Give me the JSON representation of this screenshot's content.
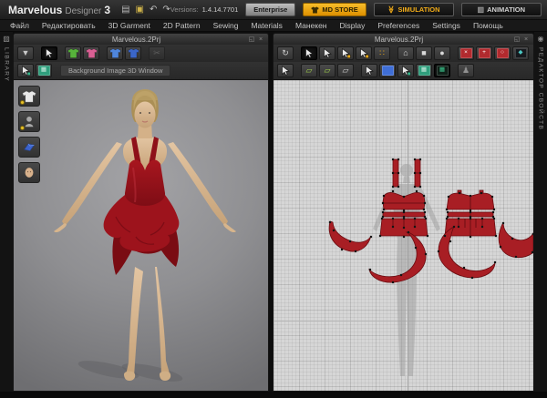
{
  "titlebar": {
    "logo": {
      "word1": "Marvelous",
      "word2": "Designer",
      "word3": "3"
    },
    "quick_icons": [
      {
        "name": "stats-icon",
        "glyph": "▤",
        "color": "#b5b5b5"
      },
      {
        "name": "open-folder-icon",
        "glyph": "▣",
        "color": "#cfb34a"
      },
      {
        "name": "undo-icon",
        "glyph": "↶",
        "color": "#bdbdbd"
      },
      {
        "name": "redo-icon",
        "glyph": "↷",
        "color": "#bdbdbd"
      }
    ],
    "version_label": "Versions:",
    "version_value": "1.4.14.7701",
    "enterprise_label": "Enterprise",
    "md_store_label": "MD STORE",
    "simulation_label": "SIMULATION",
    "simulation_icon": "≫",
    "animation_label": "ANIMATION",
    "animation_icon": "▥",
    "window": {
      "minimize": "–",
      "maximize": "◻",
      "close": "×"
    }
  },
  "menubar": {
    "items": [
      {
        "id": "file",
        "label": "Файл"
      },
      {
        "id": "edit",
        "label": "Редактировать"
      },
      {
        "id": "3d-garment",
        "label": "3D Garment"
      },
      {
        "id": "2d-pattern",
        "label": "2D Pattern"
      },
      {
        "id": "sewing",
        "label": "Sewing"
      },
      {
        "id": "materials",
        "label": "Materials"
      },
      {
        "id": "avatar",
        "label": "Манекен"
      },
      {
        "id": "display",
        "label": "Display"
      },
      {
        "id": "preferences",
        "label": "Preferences"
      },
      {
        "id": "settings",
        "label": "Settings"
      },
      {
        "id": "help",
        "label": "Помощь"
      }
    ]
  },
  "strips": {
    "left_icon": "▨",
    "left_label": "LIBRARY",
    "right_icon": "◉",
    "right_label": "РЕДАКТОР СВОЙСТВ"
  },
  "pane3d": {
    "tab_title": "Marvelous.2Prj",
    "restore_glyph": "◱",
    "close_glyph": "×",
    "background_selector": "Background Image 3D Window",
    "toolbar_row1": [
      {
        "name": "show-hide-dropdown-tool",
        "kind": "glyph",
        "glyph": "▼",
        "color": "#c9c9c9"
      },
      {
        "name": "select-move-tool",
        "kind": "cursor",
        "active": true,
        "gapBefore": true
      },
      {
        "name": "show-garment-3d-toggle",
        "kind": "shirt",
        "color": "#57b33b",
        "gapBefore": true
      },
      {
        "name": "show-garment-fit-toggle",
        "kind": "shirt",
        "color": "#d95f93"
      },
      {
        "name": "drape-garment-tool",
        "kind": "shirt",
        "color": "#4f86dd",
        "gapBefore": true
      },
      {
        "name": "fit-garment-tool",
        "kind": "shirt",
        "color": "#3b66c8"
      },
      {
        "name": "scissors-tool",
        "kind": "glyph",
        "glyph": "✂",
        "color": "#9a9a9a",
        "disabled": true,
        "gapBefore": true
      }
    ],
    "toolbar_row2": [
      {
        "name": "select-background-tool",
        "kind": "cursor",
        "dot": "#35b48a"
      },
      {
        "name": "background-texture-swatch",
        "kind": "box",
        "color": "#2f9e7c",
        "glyph": "▦",
        "glyphColor": "#cdeee2"
      }
    ],
    "object_stack": [
      {
        "name": "scene-tab-garment",
        "kind": "stack-shirt",
        "badge": true
      },
      {
        "name": "scene-tab-avatar",
        "kind": "stack-bust",
        "badge": true
      },
      {
        "name": "scene-tab-fabric",
        "kind": "stack-fabric",
        "badge": false
      },
      {
        "name": "scene-tab-head",
        "kind": "stack-head",
        "badge": false
      }
    ]
  },
  "pane2d": {
    "tab_title": "Marvelous.2Prj",
    "restore_glyph": "◱",
    "close_glyph": "×",
    "toolbar_row1": [
      {
        "name": "sync-2d-3d-tool",
        "kind": "glyph",
        "glyph": "↻",
        "color": "#d2d2d2"
      },
      {
        "name": "transform-pattern-tool",
        "kind": "cursor",
        "active": true,
        "gapBefore": true
      },
      {
        "name": "transform-point-tool",
        "kind": "cursor"
      },
      {
        "name": "edit-curvature-tool",
        "kind": "cursor",
        "dot": "#e8a818"
      },
      {
        "name": "edit-curve-point-tool",
        "kind": "cursor",
        "dot": "#e8a818"
      },
      {
        "name": "add-point-split-tool",
        "kind": "glyph",
        "glyph": "∷",
        "color": "#e8a818"
      },
      {
        "name": "polygon-pattern-tool",
        "kind": "glyph",
        "glyph": "⌂",
        "color": "#d8d8d8",
        "gapBefore": true
      },
      {
        "name": "rectangle-pattern-tool",
        "kind": "glyph",
        "glyph": "■",
        "color": "#d8d8d8"
      },
      {
        "name": "circle-pattern-tool",
        "kind": "glyph",
        "glyph": "●",
        "color": "#d8d8d8"
      },
      {
        "name": "dart-x-tool",
        "kind": "box",
        "color": "#b22a2e",
        "glyph": "×",
        "glyphColor": "#ffffff",
        "gapBefore": true
      },
      {
        "name": "dart-plus-tool",
        "kind": "box",
        "color": "#b22a2e",
        "glyph": "+",
        "glyphColor": "#ffffff"
      },
      {
        "name": "dart-circle-tool",
        "kind": "box",
        "color": "#b22a2e",
        "glyph": "○",
        "glyphColor": "#ffffff"
      },
      {
        "name": "seam-point-tool",
        "kind": "box",
        "color": "#16191d",
        "glyph": "◆",
        "glyphColor": "#4cc8c4"
      }
    ],
    "toolbar_row2": [
      {
        "name": "edit-pattern-layout-tool",
        "kind": "cursor"
      },
      {
        "name": "move-pattern-tool",
        "kind": "glyph",
        "glyph": "▱",
        "color": "#9fd04a",
        "gapBefore": true
      },
      {
        "name": "mirror-pattern-tool",
        "kind": "glyph",
        "glyph": "▱",
        "color": "#9fd04a"
      },
      {
        "name": "rotate-pattern-tool",
        "kind": "glyph",
        "glyph": "▱",
        "color": "#cfcfcf"
      },
      {
        "name": "select-texture-tool",
        "kind": "cursor",
        "gapBefore": true
      },
      {
        "name": "fabric-swatch",
        "kind": "box",
        "color": "#3f6ed6",
        "glyph": "",
        "glyphColor": "#ffffff"
      },
      {
        "name": "select-grid-texture-tool",
        "kind": "cursor",
        "dot": "#35b48a"
      },
      {
        "name": "grid-texture-swatch",
        "kind": "box",
        "color": "#2f9e7c",
        "glyph": "▦",
        "glyphColor": "#cdeee2"
      },
      {
        "name": "texture-editor-toggle",
        "kind": "box",
        "color": "#0f2018",
        "glyph": "▦",
        "glyphColor": "#3ecb92",
        "active": true
      },
      {
        "name": "show-avatar-silhouette-toggle",
        "kind": "glyph",
        "glyph": "♟",
        "color": "#909090",
        "gapBefore": true
      }
    ]
  },
  "colors": {
    "accent_yellow": "#f0ab18",
    "pattern_red": "#a81e24",
    "dress_red": "#8e1019",
    "viewport2d_bg": "#d6d6d6"
  }
}
